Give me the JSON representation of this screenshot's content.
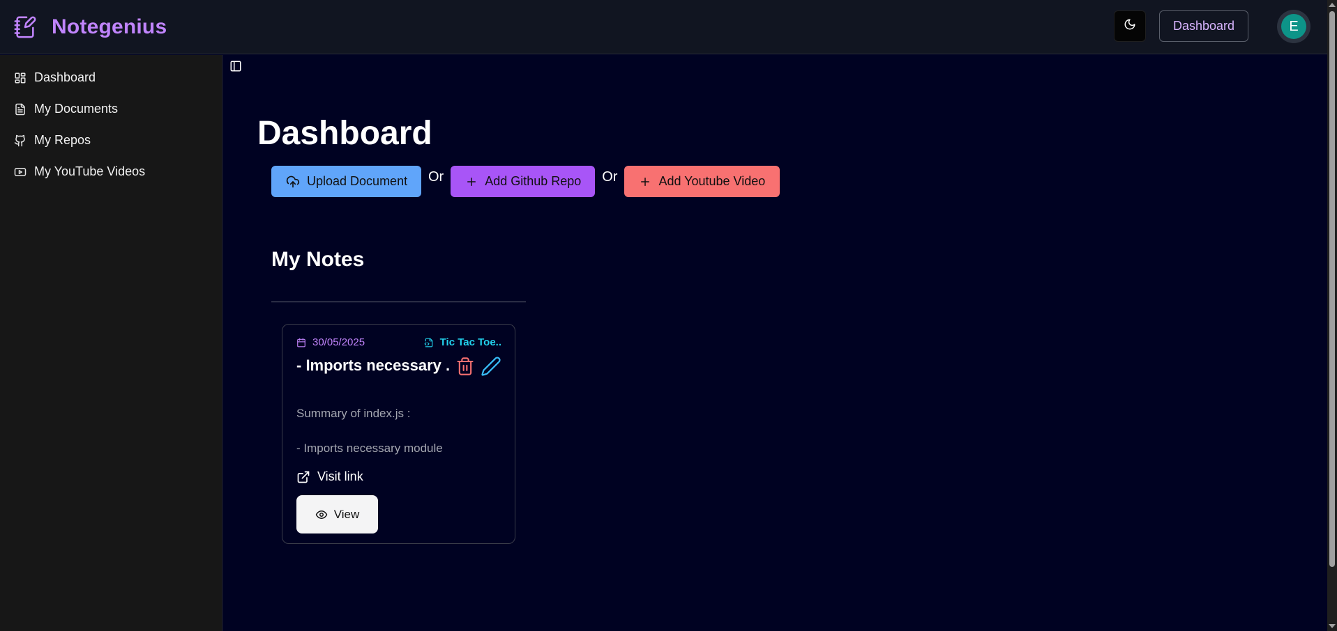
{
  "app": {
    "brand_name": "Notegenius",
    "brand_color": "#c084fc",
    "brand_icon": "notebook-pen-icon"
  },
  "header": {
    "theme_icon": "moon-icon",
    "dashboard_label": "Dashboard",
    "avatar_initial": "E"
  },
  "sidebar": {
    "items": [
      {
        "label": "Dashboard",
        "icon": "dashboard-icon"
      },
      {
        "label": "My Documents",
        "icon": "document-icon"
      },
      {
        "label": "My Repos",
        "icon": "github-icon"
      },
      {
        "label": "My YouTube Videos",
        "icon": "youtube-icon"
      }
    ]
  },
  "main": {
    "title": "Dashboard",
    "actions": {
      "upload_label": "Upload Document",
      "github_label": "Add Github Repo",
      "youtube_label": "Add Youtube Video",
      "or_text": "Or"
    },
    "section_title": "My Notes",
    "notes": [
      {
        "date": "30/05/2025",
        "source": "Tic Tac Toe..",
        "title": "- Imports necessary ..",
        "summary": "Summary of index.js :",
        "line": "- Imports necessary module",
        "link_label": "Visit link",
        "view_label": "View"
      }
    ]
  },
  "colors": {
    "upload": "#60a5fa",
    "github": "#a855f7",
    "youtube": "#f87171",
    "delete": "#f87171",
    "edit": "#38bdf8",
    "source": "#22d3ee"
  }
}
